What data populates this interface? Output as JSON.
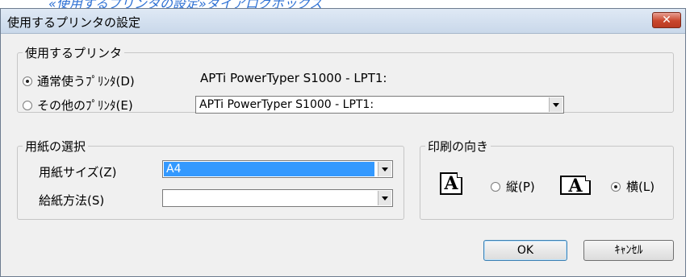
{
  "caption": "«使用するプリンタの設定»ダイアログボックス",
  "dialog": {
    "title": "使用するプリンタの設定",
    "close_glyph": "✕"
  },
  "printer_group": {
    "legend": "使用するプリンタ",
    "default_option": "通常使うﾌﾟﾘﾝﾀ(D)",
    "default_printer_name": "APTi PowerTyper S1000 - LPT1:",
    "other_option": "その他のﾌﾟﾘﾝﾀ(E)",
    "other_printer_value": "APTi PowerTyper S1000 - LPT1:",
    "selected": "default"
  },
  "paper_group": {
    "legend": "用紙の選択",
    "size_label": "用紙サイズ(Z)",
    "size_value": "A4",
    "feed_label": "給紙方法(S)",
    "feed_value": ""
  },
  "orientation_group": {
    "legend": "印刷の向き",
    "portrait_label": "縦(P)",
    "landscape_label": "横(L)",
    "icon_glyph": "A",
    "selected": "landscape"
  },
  "buttons": {
    "ok": "OK",
    "cancel": "ｷｬﾝｾﾙ"
  }
}
